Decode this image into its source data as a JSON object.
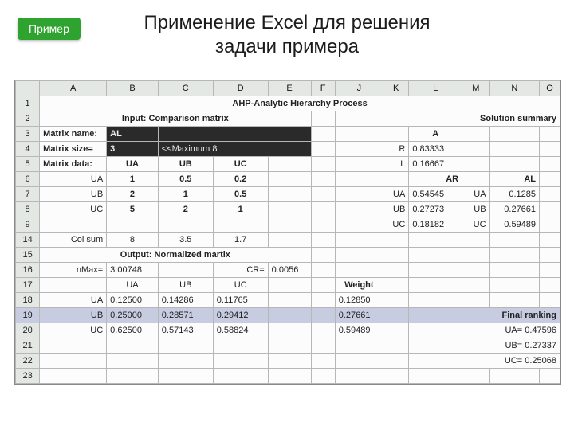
{
  "badge": {
    "label": "Пример"
  },
  "title": {
    "line1": "Применение Excel для решения",
    "line2": "задачи примера"
  },
  "cols": {
    "rowhead": "",
    "A": "A",
    "B": "B",
    "C": "C",
    "D": "D",
    "E": "E",
    "F": "F",
    "J": "J",
    "K": "K",
    "L": "L",
    "M": "M",
    "N": "N",
    "O": "O"
  },
  "rows": {
    "r1": "1",
    "r2": "2",
    "r3": "3",
    "r4": "4",
    "r5": "5",
    "r6": "6",
    "r7": "7",
    "r8": "8",
    "r9": "9",
    "r14": "14",
    "r15": "15",
    "r16": "16",
    "r17": "17",
    "r18": "18",
    "r19": "19",
    "r20": "20",
    "r21": "21",
    "r22": "22",
    "r23": "23"
  },
  "r1": {
    "title": "AHP-Analytic Hierarchy Process"
  },
  "r2": {
    "left": "Input: Comparison matrix",
    "right": "Solution summary"
  },
  "r3": {
    "label": "Matrix name:",
    "val": "AL",
    "K": "",
    "L": "A"
  },
  "r4": {
    "label": "Matrix size=",
    "val": "3",
    "note": "<<Maximum 8",
    "K": "R",
    "L": "0.83333"
  },
  "r5": {
    "label": "Matrix data:",
    "B": "UA",
    "C": "UB",
    "D": "UC",
    "K": "L",
    "L": "0.16667"
  },
  "r6": {
    "A": "UA",
    "B": "1",
    "C": "0.5",
    "D": "0.2",
    "L": "AR",
    "N": "AL"
  },
  "r7": {
    "A": "UB",
    "B": "2",
    "C": "1",
    "D": "0.5",
    "K": "UA",
    "L": "0.54545",
    "M": "UA",
    "N": "0.1285"
  },
  "r8": {
    "A": "UC",
    "B": "5",
    "C": "2",
    "D": "1",
    "K": "UB",
    "L": "0.27273",
    "M": "UB",
    "N": "0.27661"
  },
  "r9": {
    "K": "UC",
    "L": "0.18182",
    "M": "UC",
    "N": "0.59489"
  },
  "r14": {
    "A": "Col sum",
    "B": "8",
    "C": "3.5",
    "D": "1.7"
  },
  "r15": {
    "title": "Output: Normalized martix"
  },
  "r16": {
    "A": "nMax=",
    "B": "3.00748",
    "D": "CR=",
    "E": "0.0056"
  },
  "r17": {
    "B": "UA",
    "C": "UB",
    "D": "UC",
    "J": "Weight"
  },
  "r18": {
    "A": "UA",
    "B": "0.12500",
    "C": "0.14286",
    "D": "0.11765",
    "J": "0.12850"
  },
  "r19": {
    "A": "UB",
    "B": "0.25000",
    "C": "0.28571",
    "D": "0.29412",
    "J": "0.27661",
    "right": "Final ranking"
  },
  "r20": {
    "A": "UC",
    "B": "0.62500",
    "C": "0.57143",
    "D": "0.58824",
    "J": "0.59489",
    "N": "UA= 0.47596"
  },
  "r21": {
    "N": "UB= 0.27337"
  },
  "r22": {
    "N": "UC= 0.25068"
  },
  "chart_data": {
    "type": "table",
    "title": "AHP-Analytic Hierarchy Process",
    "comparison_matrix": {
      "name": "AL",
      "size": 3,
      "labels": [
        "UA",
        "UB",
        "UC"
      ],
      "values": [
        [
          1,
          0.5,
          0.2
        ],
        [
          2,
          1,
          0.5
        ],
        [
          5,
          2,
          1
        ]
      ],
      "col_sum": [
        8,
        3.5,
        1.7
      ]
    },
    "normalized_matrix": {
      "nMax": 3.00748,
      "CR": 0.0056,
      "labels": [
        "UA",
        "UB",
        "UC"
      ],
      "values": [
        [
          0.125,
          0.14286,
          0.11765
        ],
        [
          0.25,
          0.28571,
          0.29412
        ],
        [
          0.625,
          0.57143,
          0.58824
        ]
      ],
      "weight": [
        0.1285,
        0.27661,
        0.59489
      ]
    },
    "solution_summary": {
      "A": {
        "R": 0.83333,
        "L": 0.16667
      },
      "AR": {
        "UA": 0.54545,
        "UB": 0.27273,
        "UC": 0.18182
      },
      "AL": {
        "UA": 0.1285,
        "UB": 0.27661,
        "UC": 0.59489
      }
    },
    "final_ranking": {
      "UA": 0.47596,
      "UB": 0.27337,
      "UC": 0.25068
    }
  }
}
